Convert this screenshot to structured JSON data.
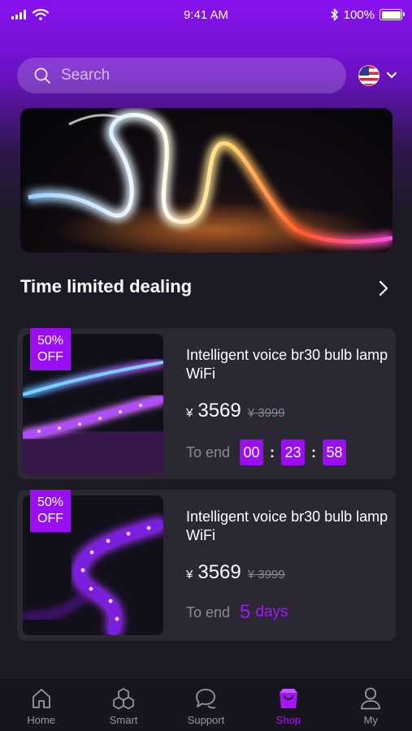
{
  "status_bar": {
    "time": "9:41 AM",
    "battery": "100%"
  },
  "search": {
    "placeholder": "Search"
  },
  "language": {
    "flag": "us-flag-icon"
  },
  "banner": {
    "image": "led-light-strip-banner"
  },
  "section": {
    "title": "Time limited dealing"
  },
  "products": [
    {
      "discount_line1": "50%",
      "discount_line2": "OFF",
      "name": "Intelligent voice br30 bulb lamp WiFi",
      "currency": "¥",
      "price": "3569",
      "old_price": "¥ 3999",
      "to_end_label": "To end",
      "countdown": {
        "hours": "00",
        "minutes": "23",
        "seconds": "58"
      }
    },
    {
      "discount_line1": "50%",
      "discount_line2": "OFF",
      "name": "Intelligent voice br30 bulb lamp WiFi",
      "currency": "¥",
      "price": "3569",
      "old_price": "¥ 3999",
      "to_end_label": "To end",
      "days_value": "5",
      "days_label": "days"
    }
  ],
  "tabs": [
    {
      "label": "Home",
      "icon": "home-icon"
    },
    {
      "label": "Smart",
      "icon": "smart-cubes-icon"
    },
    {
      "label": "Support",
      "icon": "chat-bubble-icon"
    },
    {
      "label": "Shop",
      "icon": "shopping-bag-icon",
      "active": true
    },
    {
      "label": "My",
      "icon": "user-icon"
    }
  ],
  "colors": {
    "accent": "#9b0df2",
    "background": "#1d1a26",
    "card": "#2b2834"
  }
}
